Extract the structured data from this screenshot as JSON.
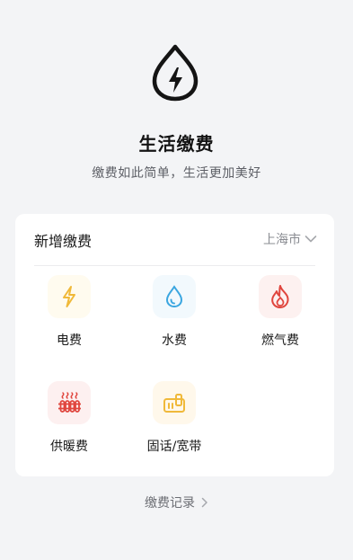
{
  "hero": {
    "icon": "lightning-drop-icon",
    "title": "生活缴费",
    "subtitle": "缴费如此简单，生活更加美好"
  },
  "card": {
    "title": "新增缴费",
    "city": "上海市",
    "city_icon": "chevron-down-icon",
    "services": [
      {
        "label": "电费",
        "icon": "lightning-icon",
        "color": "#f0b93a"
      },
      {
        "label": "水费",
        "icon": "water-drop-icon",
        "color": "#3aa6e0"
      },
      {
        "label": "燃气费",
        "icon": "flame-icon",
        "color": "#e0453d"
      },
      {
        "label": "供暖费",
        "icon": "radiator-icon",
        "color": "#e0453d"
      },
      {
        "label": "固话/宽带",
        "icon": "phone-icon",
        "color": "#f0b93a"
      }
    ]
  },
  "footer": {
    "records_label": "缴费记录",
    "records_icon": "chevron-right-icon"
  }
}
